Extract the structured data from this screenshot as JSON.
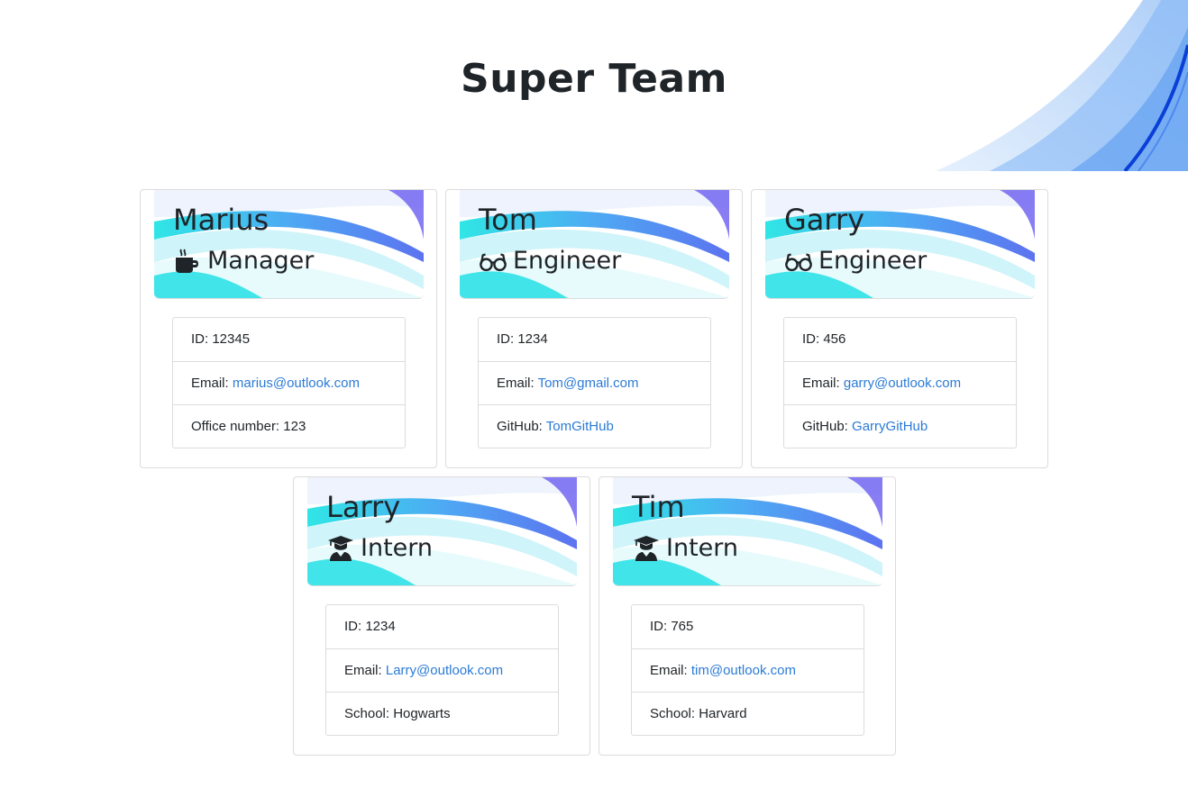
{
  "page": {
    "title": "Super Team"
  },
  "employees": [
    {
      "name": "Marius",
      "role": "Manager",
      "role_icon": "coffee-mug-icon",
      "id_label": "ID:",
      "id": "12345",
      "email_label": "Email:",
      "email": "marius@outlook.com",
      "extra_label": "Office number:",
      "extra_value": "123"
    },
    {
      "name": "Tom",
      "role": "Engineer",
      "role_icon": "glasses-icon",
      "id_label": "ID:",
      "id": "1234",
      "email_label": "Email:",
      "email": "Tom@gmail.com",
      "extra_label": "GitHub:",
      "extra_value": "TomGitHub"
    },
    {
      "name": "Garry",
      "role": "Engineer",
      "role_icon": "glasses-icon",
      "id_label": "ID:",
      "id": "456",
      "email_label": "Email:",
      "email": "garry@outlook.com",
      "extra_label": "GitHub:",
      "extra_value": "GarryGitHub"
    },
    {
      "name": "Larry",
      "role": "Intern",
      "role_icon": "graduate-icon",
      "id_label": "ID:",
      "id": "1234",
      "email_label": "Email:",
      "email": "Larry@outlook.com",
      "extra_label": "School:",
      "extra_value": "Hogwarts"
    },
    {
      "name": "Tim",
      "role": "Intern",
      "role_icon": "graduate-icon",
      "id_label": "ID:",
      "id": "765",
      "email_label": "Email:",
      "email": "tim@outlook.com",
      "extra_label": "School:",
      "extra_value": "Harvard"
    }
  ],
  "colors": {
    "link": "#2b7bd6",
    "wave_blue": "#1e6fe8",
    "wave_cyan": "#19e0e6",
    "text": "#1f2429"
  }
}
